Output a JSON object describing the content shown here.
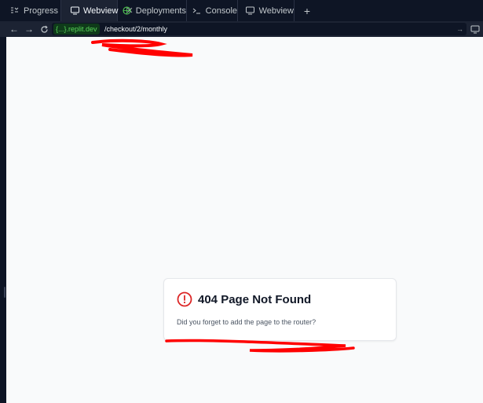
{
  "tabs": [
    {
      "label": "Progress",
      "icon": "progress-icon",
      "active": false
    },
    {
      "label": "Webview",
      "icon": "monitor-icon",
      "active": true,
      "closable": true
    },
    {
      "label": "Deployments",
      "icon": "deployments-icon",
      "active": false
    },
    {
      "label": "Console",
      "icon": "console-icon",
      "active": false
    },
    {
      "label": "Webview",
      "icon": "monitor-icon",
      "active": false
    }
  ],
  "add_tab_label": "+",
  "urlbar": {
    "domain": "{...}.replit.dev",
    "path": "/checkout/2/monthly"
  },
  "page": {
    "title": "404 Page Not Found",
    "message": "Did you forget to add the page to the router?"
  },
  "colors": {
    "accent_error": "#dc2626",
    "domain_green": "#5ad75a",
    "annotation_red": "#ff0000"
  }
}
